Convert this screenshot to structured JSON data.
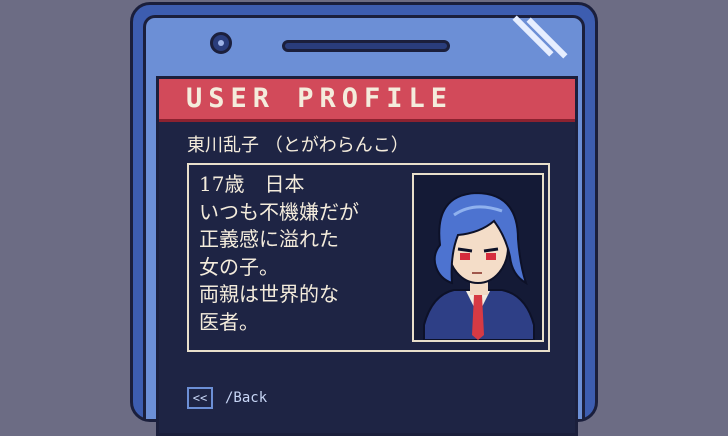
{
  "header": {
    "title": "USER PROFILE"
  },
  "profile": {
    "name": "東川乱子 （とがわらんこ）",
    "bio": [
      "17歳　日本",
      "いつも不機嫌だが",
      "正義感に溢れた",
      "女の子。",
      "両親は世界的な",
      "医者。"
    ]
  },
  "nav": {
    "back_icon": "<<",
    "back_label": "/Back"
  },
  "colors": {
    "background": "#6c6c84",
    "phone_body": "#3d5db0",
    "phone_face": "#6c8fd6",
    "screen": "#1e2444",
    "header": "#d24a5a",
    "text": "#f4ecdc"
  }
}
